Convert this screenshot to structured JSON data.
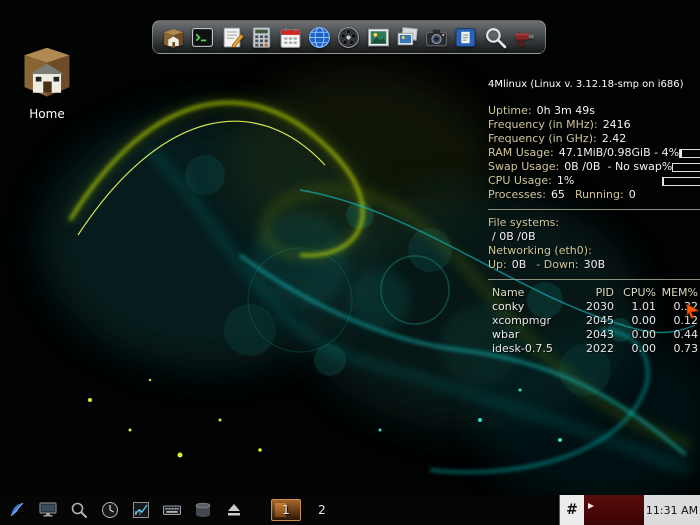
{
  "desktop": {
    "home_icon_label": "Home",
    "accent_colors": {
      "swirl_yellow": "#d6f000",
      "swirl_cyan": "#18e0e0",
      "bokeh_teal": "#0d4f4c"
    }
  },
  "dock": {
    "items": [
      {
        "name": "file-manager"
      },
      {
        "name": "terminal"
      },
      {
        "name": "text-editor"
      },
      {
        "name": "calculator"
      },
      {
        "name": "calendar"
      },
      {
        "name": "web-browser"
      },
      {
        "name": "media-player"
      },
      {
        "name": "image-viewer"
      },
      {
        "name": "photo-gallery"
      },
      {
        "name": "camera"
      },
      {
        "name": "documents"
      },
      {
        "name": "search"
      },
      {
        "name": "tools"
      }
    ]
  },
  "conky": {
    "title": "4Mlinux (Linux v. 3.12.18-smp on i686)",
    "uptime": {
      "label": "Uptime:",
      "value": "0h 3m 49s"
    },
    "freq_mhz": {
      "label": "Frequency (in MHz):",
      "value": "2416"
    },
    "freq_ghz": {
      "label": "Frequency (in GHz):",
      "value": "2.42"
    },
    "ram": {
      "label": "RAM Usage:",
      "value": "47.1MiB/0.98GiB - 4%",
      "bar_pct": 4
    },
    "swap": {
      "label": "Swap Usage:",
      "value": "0B /0B  - No swap%",
      "bar_pct": 0
    },
    "cpu": {
      "label": "CPU Usage:",
      "value": "1%",
      "bar_pct": 1
    },
    "processes": {
      "label": "Processes:",
      "value": "65",
      "label2": "Running:",
      "value2": "0"
    },
    "filesystems": {
      "header": "File systems:",
      "root_line": "/ 0B /0B"
    },
    "networking": {
      "header": "Networking (eth0):",
      "up_label": "Up:",
      "up_value": "0B",
      "down_label": "- Down:",
      "down_value": "30B"
    },
    "process_table": {
      "headers": [
        "Name",
        "PID",
        "CPU%",
        "MEM%"
      ],
      "rows": [
        [
          "conky",
          "2030",
          "1.01",
          "0.32"
        ],
        [
          "xcompmgr",
          "2045",
          "0.00",
          "0.12"
        ],
        [
          "wbar",
          "2043",
          "0.00",
          "0.44"
        ],
        [
          "idesk-0.7.5",
          "2022",
          "0.00",
          "0.73"
        ]
      ]
    }
  },
  "taskbar": {
    "icons": [
      "x11",
      "display",
      "search",
      "clock-gauge",
      "chart",
      "keyboard",
      "storage",
      "eject"
    ],
    "workspaces": [
      {
        "label": "1",
        "active": true
      },
      {
        "label": "2",
        "active": false
      }
    ],
    "hash_label": "#",
    "clock": "11:31 AM"
  }
}
